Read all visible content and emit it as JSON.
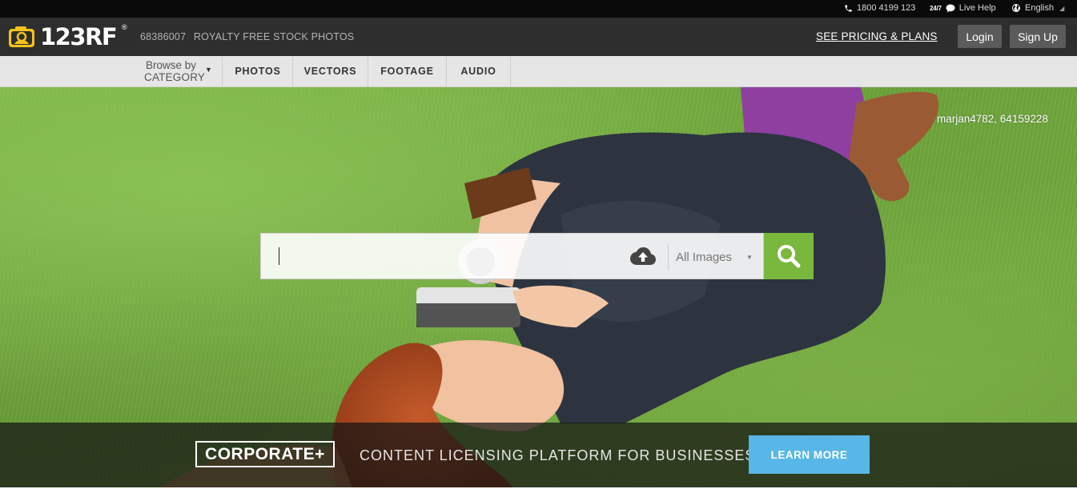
{
  "topbar": {
    "phone": "1800 4199 123",
    "support_tag": "24/7",
    "live_help": "Live Help",
    "language": "English"
  },
  "header": {
    "logo_text": "123RF",
    "logo_mark": "®",
    "stock_count": "68386007",
    "tagline": "ROYALTY FREE STOCK PHOTOS",
    "pricing_link": "SEE PRICING & PLANS",
    "login_label": "Login",
    "signup_label": "Sign Up"
  },
  "catnav": {
    "browse_line1": "Browse by",
    "browse_line2": "CATEGORY",
    "browse_arrow": "▼",
    "tabs": [
      {
        "label": "PHOTOS"
      },
      {
        "label": "VECTORS"
      },
      {
        "label": "FOOTAGE"
      },
      {
        "label": "AUDIO"
      }
    ]
  },
  "hero": {
    "photo_credit": "marjan4782, 64159228",
    "search": {
      "value": "",
      "filter_selected": "All Images",
      "filter_arrow": "▼"
    }
  },
  "banner": {
    "corporate_logo": "CORPORATE+",
    "headline": "CONTENT LICENSING PLATFORM FOR BUSINESSES",
    "cta": "LEARN MORE"
  },
  "colors": {
    "accent_green": "#7ab83d",
    "cta_blue": "#58b7e6",
    "header_bg": "#2e2e2e",
    "logo_yellow": "#f6c21a"
  },
  "icons": [
    "phone-icon",
    "chat-icon",
    "globe-icon",
    "upload-cloud-icon",
    "search-icon",
    "camera-logo-icon"
  ]
}
